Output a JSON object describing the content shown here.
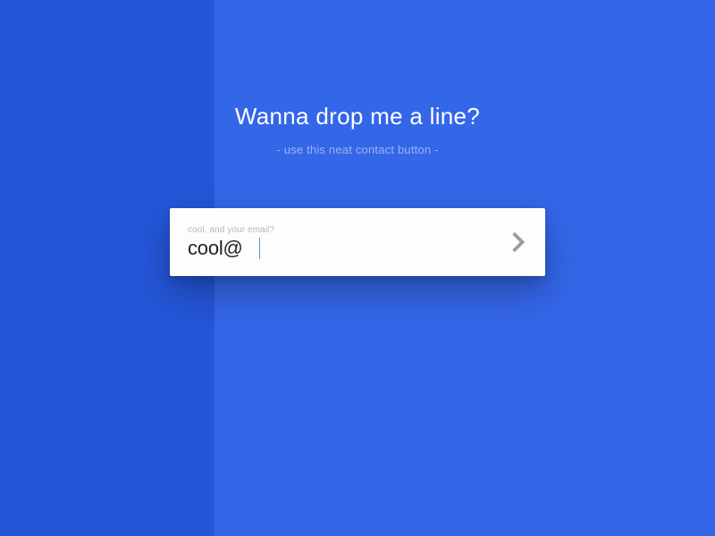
{
  "header": {
    "title": "Wanna drop me a line?",
    "subtitle": "- use this neat contact button -"
  },
  "form": {
    "email_label": "cool, and your email?",
    "email_value": "cool@",
    "submit_icon": "chevron-right-icon"
  },
  "colors": {
    "bg_left": "#2456d8",
    "bg_right": "#3466e8",
    "text_white": "#ffffff",
    "text_muted": "#9ab4f0",
    "card_bg": "#fdfdfb",
    "label_gray": "#b8b8b8",
    "input_text": "#222222",
    "chevron_gray": "#9c9c9c"
  }
}
